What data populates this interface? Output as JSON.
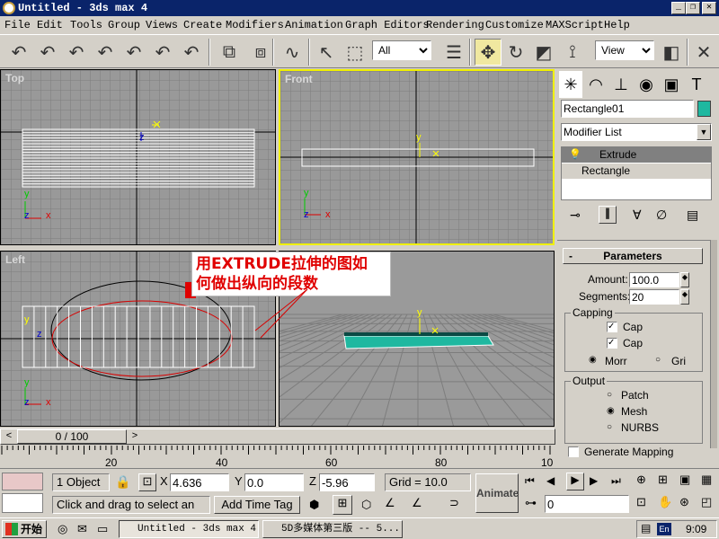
{
  "window": {
    "title": "Untitled - 3ds max 4",
    "min": "_",
    "max": "□",
    "close": "✕",
    "restore": "❐"
  },
  "menu": [
    "File",
    "Edit",
    "Tools",
    "Group",
    "Views",
    "Create",
    "Modifiers",
    "Animation",
    "Graph Editors",
    "Rendering",
    "Customize",
    "MAXScript",
    "Help"
  ],
  "toolbar": {
    "selection_filter": "All",
    "ref_coord": "View"
  },
  "viewports": {
    "top": "Top",
    "front": "Front",
    "left": "Left",
    "perspective": ""
  },
  "annotation": {
    "line1": "用EXTRUDE拉伸的图如",
    "line2": "何做出纵向的段数"
  },
  "axes": {
    "x": "x",
    "y": "y",
    "z": "z"
  },
  "timeslider": {
    "frame": "0 / 100",
    "prev": "<",
    "next": ">"
  },
  "ruler_ticks": [
    "20",
    "40",
    "60",
    "80",
    "10"
  ],
  "cmd_panel": {
    "object_name": "Rectangle01",
    "object_color": "#1fb8a0",
    "modifier_list": "Modifier List",
    "stack": [
      "Extrude",
      "Rectangle"
    ],
    "rollout_title": "Parameters",
    "rollout_toggle": "-",
    "amount_label": "Amount:",
    "amount_value": "100.0",
    "segments_label": "Segments:",
    "segments_value": "20",
    "capping_label": "Capping",
    "cap_start": "Cap",
    "cap_end": "Cap",
    "morph": "Morr",
    "grid": "Gri",
    "output_label": "Output",
    "patch": "Patch",
    "mesh": "Mesh",
    "nurbs": "NURBS",
    "gen_mapping": "Generate Mapping"
  },
  "status": {
    "selection": "1 Object",
    "x_label": "X",
    "x": "4.636",
    "y_label": "Y",
    "y": "0.0",
    "z_label": "Z",
    "z": "-5.96",
    "grid": "Grid = 10.0",
    "prompt": "Click and drag to select an",
    "add_time_tag": "Add Time Tag",
    "animate": "Animate",
    "frame_field": "0"
  },
  "taskbar": {
    "start": "开始",
    "tasks": [
      "Untitled - 3ds max 4",
      "5D多媒体第三版 -- 5..."
    ],
    "clock": "9:09",
    "lang": "En"
  },
  "colors": {
    "viewport_bg": "#999999",
    "active_border": "#f0f000",
    "selection": "#ffffff",
    "red_shape": "#d80000"
  }
}
